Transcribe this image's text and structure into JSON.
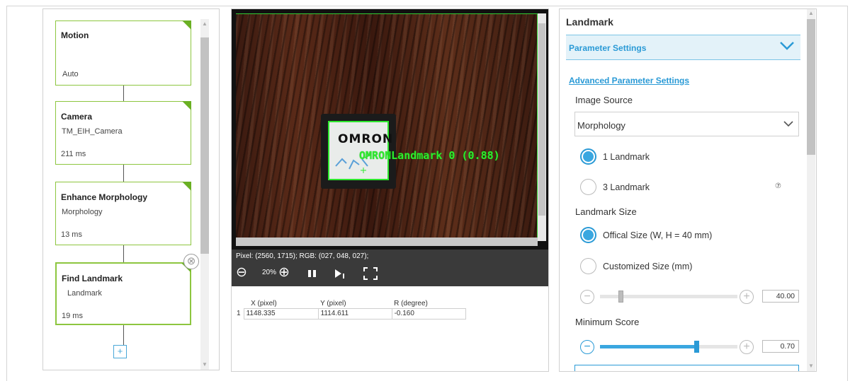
{
  "flow": {
    "nodes": [
      {
        "title": "Motion",
        "sub": "",
        "time": "Auto"
      },
      {
        "title": "Camera",
        "sub": "TM_EIH_Camera",
        "time": "211 ms"
      },
      {
        "title": "Enhance Morphology",
        "sub": "Morphology",
        "time": "13 ms"
      },
      {
        "title": "Find Landmark",
        "sub": "Landmark",
        "time": "19 ms"
      }
    ],
    "close_glyph": "⊗",
    "add_glyph": "+"
  },
  "viewer": {
    "landmark_brand": "OMRON",
    "overlay_label": "OMRONLandmark 0 (0.88)",
    "pixel_info": "Pixel: (2560, 1715); RGB: (027, 048, 027);",
    "zoom": "20%"
  },
  "results": {
    "headers": [
      "X (pixel)",
      "Y (pixel)",
      "R (degree)"
    ],
    "rows": [
      {
        "index": "1",
        "x": "1148.335",
        "y": "1114.611",
        "r": "-0.160"
      }
    ]
  },
  "settings": {
    "title": "Landmark",
    "accordion_label": "Parameter Settings",
    "advanced_link": "Advanced Parameter Settings",
    "image_source_label": "Image Source",
    "image_source_value": "Morphology",
    "landmark_count_options": [
      {
        "label": "1 Landmark",
        "selected": true
      },
      {
        "label": "3 Landmark",
        "selected": false
      }
    ],
    "help_glyph": "⑦",
    "landmark_size_label": "Landmark Size",
    "landmark_size_options": [
      {
        "label": "Offical Size (W, H = 40 mm)",
        "selected": true
      },
      {
        "label": "Customized Size (mm)",
        "selected": false
      }
    ],
    "size_slider": {
      "value": "40.00",
      "fraction": 0.15,
      "enabled": false
    },
    "min_score_label": "Minimum Score",
    "score_slider": {
      "value": "0.70",
      "fraction": 0.7,
      "enabled": true
    }
  },
  "colors": {
    "accent": "#2a9ad6",
    "node_border": "#8dc63f",
    "detection_green": "#2ee82e"
  }
}
